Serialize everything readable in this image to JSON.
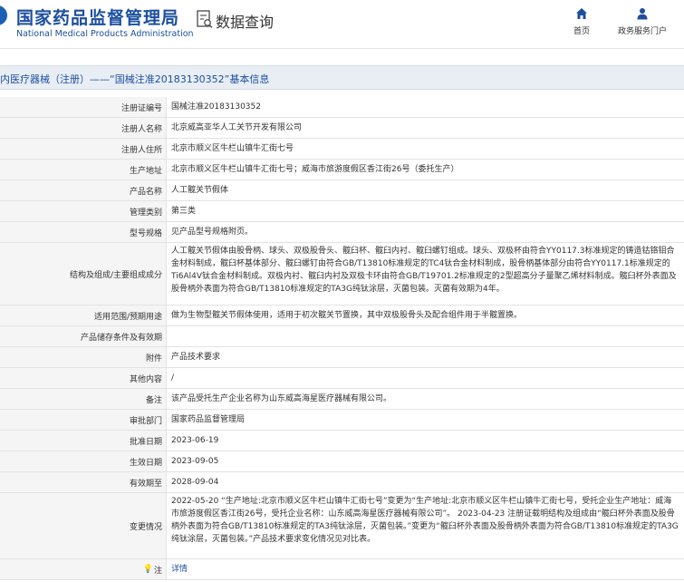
{
  "header": {
    "logo_cn": "国家药品监督管理局",
    "logo_en": "National Medical Products Administration",
    "query_title": "数据查询",
    "nav": [
      {
        "label": "首页",
        "icon": "home-icon"
      },
      {
        "label": "政务服务门户",
        "icon": "user-icon"
      }
    ]
  },
  "section_title": "内医疗器械（注册）——“国械注准20183130352”基本信息",
  "rows": [
    {
      "label": "注册证编号",
      "value": "国械注准20183130352"
    },
    {
      "label": "注册人名称",
      "value": "北京威高亚华人工关节开发有限公司"
    },
    {
      "label": "注册人住所",
      "value": "北京市顺义区牛栏山镇牛汇街七号"
    },
    {
      "label": "生产地址",
      "value": "北京市顺义区牛栏山镇牛汇街七号；威海市旅游度假区香江街26号（委托生产）"
    },
    {
      "label": "产品名称",
      "value": "人工髋关节假体"
    },
    {
      "label": "管理类别",
      "value": "第三类"
    },
    {
      "label": "型号规格",
      "value": "见产品型号规格附页。"
    },
    {
      "label": "结构及组成/主要组成成分",
      "value": "人工髋关节假体由股骨柄、球头、双极股骨头、髋臼杯、髋臼内衬、髋臼螺钉组成。球头、双极杯由符合YY0117.3标准规定的铸造钴铬钼合金材料制成，髋臼杯基体部分、髋臼螺钉由符合GB/T13810标准规定的TC4钛合金材料制成，股骨柄基体部分由符合YY0117.1标准规定的Ti6Al4V钛合金材料制成。双极内衬、髋臼内衬及双极卡环由符合GB/T19701.2标准规定的2型超高分子量聚乙烯材料制成。髋臼杯外表面及股骨柄外表面为符合GB/T13810标准规定的TA3G纯钛涂层，灭菌包装。灭菌有效期为4年。"
    },
    {
      "label": "适用范围/预期用途",
      "value": "做为生物型髋关节假体使用，适用于初次髋关节置换，其中双极股骨头及配合组件用于半髋置换。"
    },
    {
      "label": "产品储存条件及有效期",
      "value": ""
    },
    {
      "label": "附件",
      "value": "产品技术要求"
    },
    {
      "label": "其他内容",
      "value": "/"
    },
    {
      "label": "备注",
      "value": "该产品受托生产企业名称为山东威高海星医疗器械有限公司。"
    },
    {
      "label": "审批部门",
      "value": "国家药品监督管理局"
    },
    {
      "label": "批准日期",
      "value": "2023-06-19"
    },
    {
      "label": "生效日期",
      "value": "2023-09-05"
    },
    {
      "label": "有效期至",
      "value": "2028-09-04"
    },
    {
      "label": "变更情况",
      "value": "2022-05-20 “生产地址:北京市顺义区牛栏山镇牛汇街七号”变更为“生产地址:北京市顺义区牛栏山镇牛汇街七号，受托企业生产地址：威海市旅游度假区香江街26号，受托企业名称：山东威高海星医疗器械有限公司”。 2023-04-23 注册证载明结构及组成由“髋臼杯外表面及股骨柄外表面为符合GB/T13810标准规定的TA3纯钛涂层，灭菌包装。”变更为“髋臼杯外表面及股骨柄外表面为符合GB/T13810标准规定的TA3G纯钛涂层，灭菌包装。”产品技术要求变化情况见对比表。"
    },
    {
      "label": "注",
      "pin": "💡",
      "value": "详情"
    }
  ]
}
